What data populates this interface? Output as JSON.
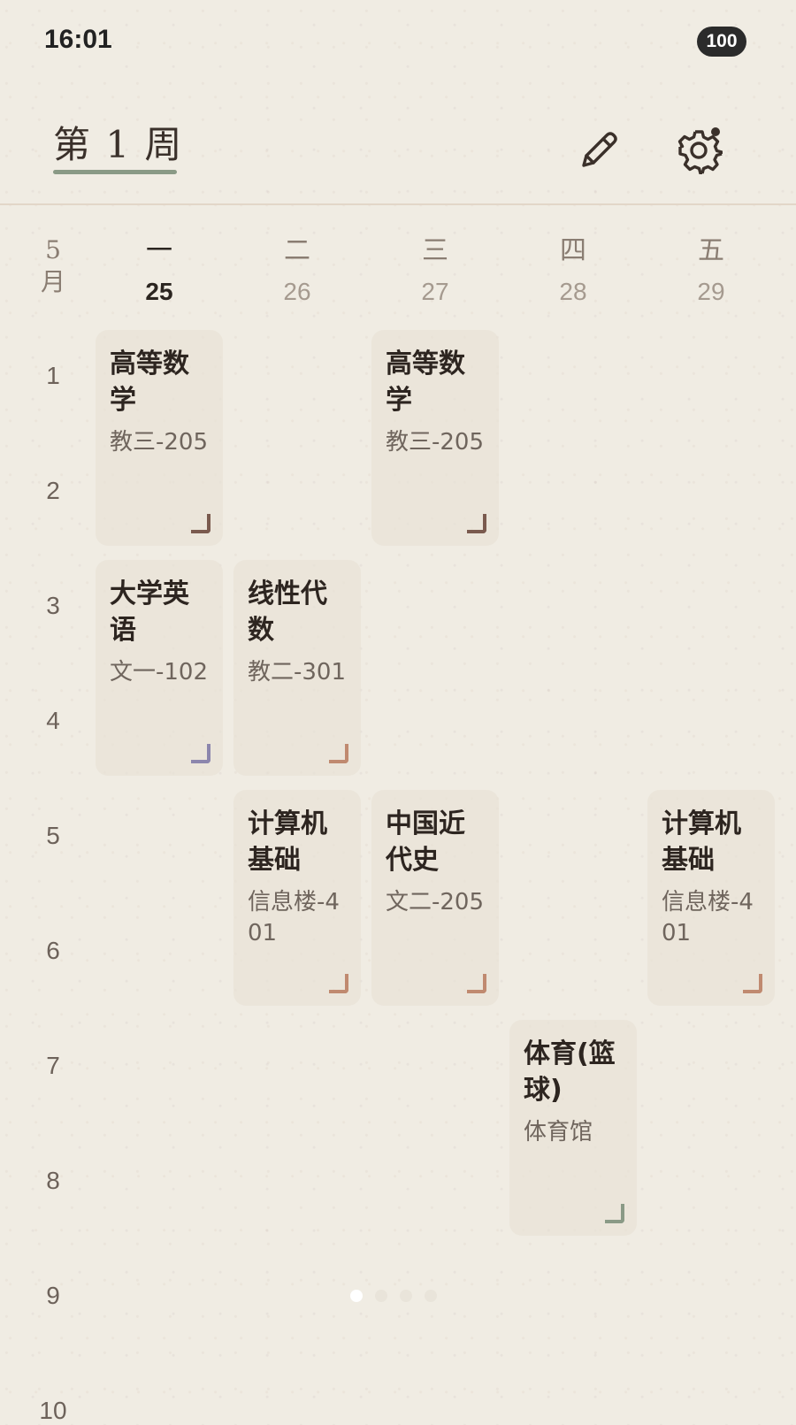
{
  "status_bar": {
    "time": "16:01",
    "battery": "100"
  },
  "header": {
    "week_title": "第 1 周"
  },
  "month_label": "5\n月",
  "days": [
    {
      "name": "一",
      "date": "25",
      "today": true
    },
    {
      "name": "二",
      "date": "26",
      "today": false
    },
    {
      "name": "三",
      "date": "27",
      "today": false
    },
    {
      "name": "四",
      "date": "28",
      "today": false
    },
    {
      "name": "五",
      "date": "29",
      "today": false
    }
  ],
  "periods": [
    "1",
    "2",
    "3",
    "4",
    "5",
    "6",
    "7",
    "8",
    "9",
    "10"
  ],
  "courses": [
    {
      "name": "高等数学",
      "room": "教三-205",
      "day": 1,
      "start": 1,
      "span": 2,
      "corner_color": "#7a5a4e"
    },
    {
      "name": "高等数学",
      "room": "教三-205",
      "day": 3,
      "start": 1,
      "span": 2,
      "corner_color": "#7a5a4e"
    },
    {
      "name": "大学英语",
      "room": "文一-102",
      "day": 1,
      "start": 3,
      "span": 2,
      "corner_color": "#8c86ad"
    },
    {
      "name": "线性代数",
      "room": "教二-301",
      "day": 2,
      "start": 3,
      "span": 2,
      "corner_color": "#c08a70"
    },
    {
      "name": "计算机基础",
      "room": "信息楼-401",
      "day": 2,
      "start": 5,
      "span": 2,
      "corner_color": "#c08a70"
    },
    {
      "name": "中国近代史",
      "room": "文二-205",
      "day": 3,
      "start": 5,
      "span": 2,
      "corner_color": "#c08a70"
    },
    {
      "name": "计算机基础",
      "room": "信息楼-401",
      "day": 5,
      "start": 5,
      "span": 2,
      "corner_color": "#c08a70"
    },
    {
      "name": "体育(篮球)",
      "room": "体育馆",
      "day": 4,
      "start": 7,
      "span": 2,
      "corner_color": "#8a9a86"
    }
  ],
  "icons": {
    "edit": "pencil-icon",
    "settings": "gear-icon"
  },
  "pagination": {
    "count": 4,
    "active": 0
  }
}
